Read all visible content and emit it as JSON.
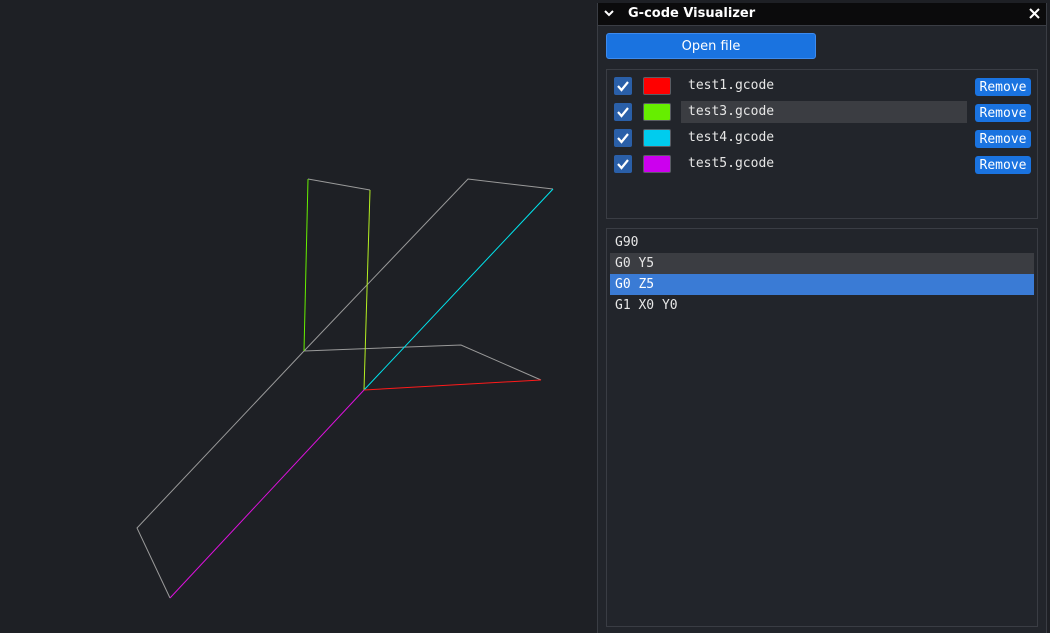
{
  "window": {
    "title": "G-code Visualizer",
    "collapse_icon": "chevron-down-icon",
    "close_icon": "close-icon"
  },
  "open_file_label": "Open file",
  "files": [
    {
      "name": "test1.gcode",
      "color": "#ff0000",
      "checked": true,
      "remove_label": "Remove"
    },
    {
      "name": "test3.gcode",
      "color": "#66ee00",
      "checked": true,
      "remove_label": "Remove"
    },
    {
      "name": "test4.gcode",
      "color": "#00ccee",
      "checked": true,
      "remove_label": "Remove"
    },
    {
      "name": "test5.gcode",
      "color": "#cc00ee",
      "checked": true,
      "remove_label": "Remove"
    }
  ],
  "gcode_lines": [
    "G90",
    "G0 Y5",
    "G0 Z5",
    "G1 X0 Y0"
  ],
  "colors": {
    "path_neutral": "#9a9a9a",
    "highlight_row": "#3a7bd5",
    "accent": "#1a73e0"
  }
}
